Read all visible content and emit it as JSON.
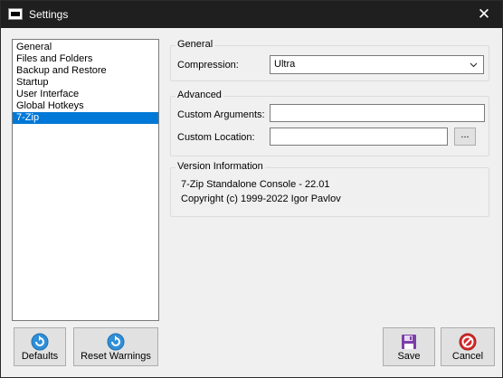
{
  "window": {
    "title": "Settings",
    "close_glyph": "✕"
  },
  "sidebar": {
    "items": [
      {
        "label": "General",
        "selected": false
      },
      {
        "label": "Files and Folders",
        "selected": false
      },
      {
        "label": "Backup and Restore",
        "selected": false
      },
      {
        "label": "Startup",
        "selected": false
      },
      {
        "label": "User Interface",
        "selected": false
      },
      {
        "label": "Global Hotkeys",
        "selected": false
      },
      {
        "label": "7-Zip",
        "selected": true
      }
    ]
  },
  "general_group": {
    "title": "General",
    "compression_label": "Compression:",
    "compression_value": "Ultra"
  },
  "advanced_group": {
    "title": "Advanced",
    "custom_arguments_label": "Custom Arguments:",
    "custom_arguments_value": "",
    "custom_location_label": "Custom Location:",
    "custom_location_value": "",
    "browse_label": "..."
  },
  "version_group": {
    "title": "Version Information",
    "line1": "7-Zip Standalone Console - 22.01",
    "line2": "Copyright (c) 1999-2022 Igor Pavlov"
  },
  "buttons": {
    "defaults": "Defaults",
    "reset_warnings": "Reset Warnings",
    "save": "Save",
    "cancel": "Cancel"
  },
  "colors": {
    "selection": "#0078d7",
    "titlebar": "#1f1f1f",
    "refresh_icon": "#2f8fd8",
    "save_icon": "#7b3fa7",
    "cancel_icon": "#d42a2a"
  }
}
